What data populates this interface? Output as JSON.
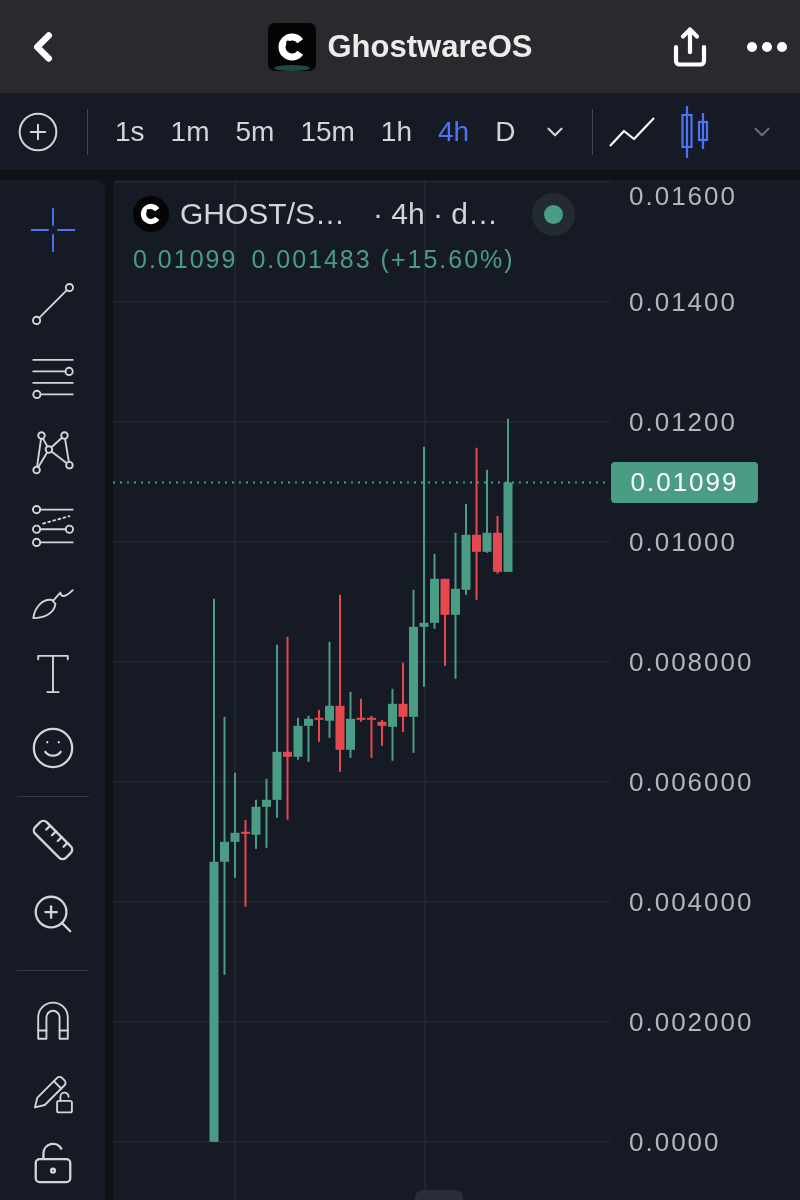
{
  "header": {
    "title": "GhostwareOS"
  },
  "toolbar": {
    "intervals": [
      {
        "label": "1s",
        "selected": false
      },
      {
        "label": "1m",
        "selected": false
      },
      {
        "label": "5m",
        "selected": false
      },
      {
        "label": "15m",
        "selected": false
      },
      {
        "label": "1h",
        "selected": false
      },
      {
        "label": "4h",
        "selected": true
      },
      {
        "label": "D",
        "selected": false
      }
    ],
    "chart_types": [
      {
        "kind": "line",
        "selected": false
      },
      {
        "kind": "candles",
        "selected": true
      }
    ]
  },
  "tool_groups": [
    {
      "tools": [
        {
          "kind": "crosshair",
          "selected": true
        },
        {
          "kind": "trend-line",
          "selected": false
        },
        {
          "kind": "horizontal-lines",
          "selected": false
        },
        {
          "kind": "pattern",
          "selected": false
        },
        {
          "kind": "fibonacci",
          "selected": false
        },
        {
          "kind": "brush",
          "selected": false
        },
        {
          "kind": "text",
          "selected": false
        },
        {
          "kind": "emoji",
          "selected": false
        }
      ]
    },
    {
      "tools": [
        {
          "kind": "ruler",
          "selected": false
        },
        {
          "kind": "zoom",
          "selected": false
        }
      ]
    },
    {
      "tools": [
        {
          "kind": "magnet",
          "selected": false
        },
        {
          "kind": "lock-drawings",
          "selected": false
        },
        {
          "kind": "lock",
          "selected": false
        }
      ]
    }
  ],
  "chart": {
    "legend": {
      "symbol": "GHOST/S…",
      "details": "· 4h · d…",
      "last": "0.01099",
      "change": "0.001483 (+15.60%)"
    },
    "chart_data": {
      "type": "candlestick",
      "grid": true,
      "ohlc": [
        [
          0,
          0.00905,
          0,
          0.004667
        ],
        [
          0.004667,
          0.007083,
          0.002783,
          0.005
        ],
        [
          0.005,
          0.00615,
          0.0044,
          0.00515
        ],
        [
          0.005167,
          0.005367,
          0.003917,
          0.005133
        ],
        [
          0.005117,
          0.0057,
          0.004883,
          0.005583
        ],
        [
          0.005583,
          0.00605,
          0.0049,
          0.0057
        ],
        [
          0.0057,
          0.008283,
          0.0054,
          0.0065
        ],
        [
          0.0065,
          0.008417,
          0.005367,
          0.006417
        ],
        [
          0.006417,
          0.007067,
          0.006367,
          0.006933
        ],
        [
          0.006933,
          0.0071,
          0.006333,
          0.00705
        ],
        [
          0.007067,
          0.0072,
          0.006667,
          0.007033
        ],
        [
          0.007017,
          0.008333,
          0.006733,
          0.007267
        ],
        [
          0.007267,
          0.009117,
          0.006167,
          0.006533
        ],
        [
          0.006533,
          0.0075,
          0.0064,
          0.00705
        ],
        [
          0.007067,
          0.007383,
          0.007,
          0.007033
        ],
        [
          0.007067,
          0.0071,
          0.0064,
          0.007033
        ],
        [
          0.007,
          0.007033,
          0.0066,
          0.006933
        ],
        [
          0.006917,
          0.00755,
          0.00635,
          0.0073
        ],
        [
          0.0073,
          0.007983,
          0.006833,
          0.007083
        ],
        [
          0.007083,
          0.0092,
          0.006483,
          0.008583
        ],
        [
          0.008583,
          0.011583,
          0.007583,
          0.00865
        ],
        [
          0.00865,
          0.0098,
          0.00855,
          0.009383
        ],
        [
          0.009383,
          0.009383,
          0.007933,
          0.008783
        ],
        [
          0.008783,
          0.01015,
          0.007717,
          0.009217
        ],
        [
          0.0092,
          0.010633,
          0.009117,
          0.010117
        ],
        [
          0.010117,
          0.011567,
          0.009033,
          0.009833
        ],
        [
          0.009833,
          0.0112,
          0.009817,
          0.01015
        ],
        [
          0.01015,
          0.010433,
          0.009467,
          0.0095
        ],
        [
          0.0095,
          0.01205,
          0.0095,
          0.01099
        ]
      ],
      "ref_lines": [
        {
          "axis": "y",
          "value": 0.01099,
          "label": "0.01099",
          "color": "#4a9d84"
        }
      ],
      "ylim": [
        -0.00097,
        0.01603
      ],
      "yticks": [
        {
          "value": 0,
          "label": "0.0000"
        },
        {
          "value": 0.002,
          "label": "0.002000"
        },
        {
          "value": 0.004,
          "label": "0.004000"
        },
        {
          "value": 0.006,
          "label": "0.006000"
        },
        {
          "value": 0.008,
          "label": "0.008000"
        },
        {
          "value": 0.01,
          "label": "0.01000"
        },
        {
          "value": 0.012,
          "label": "0.01200"
        },
        {
          "value": 0.014,
          "label": "0.01400"
        },
        {
          "value": 0.016,
          "label": "0.01600"
        }
      ]
    }
  }
}
